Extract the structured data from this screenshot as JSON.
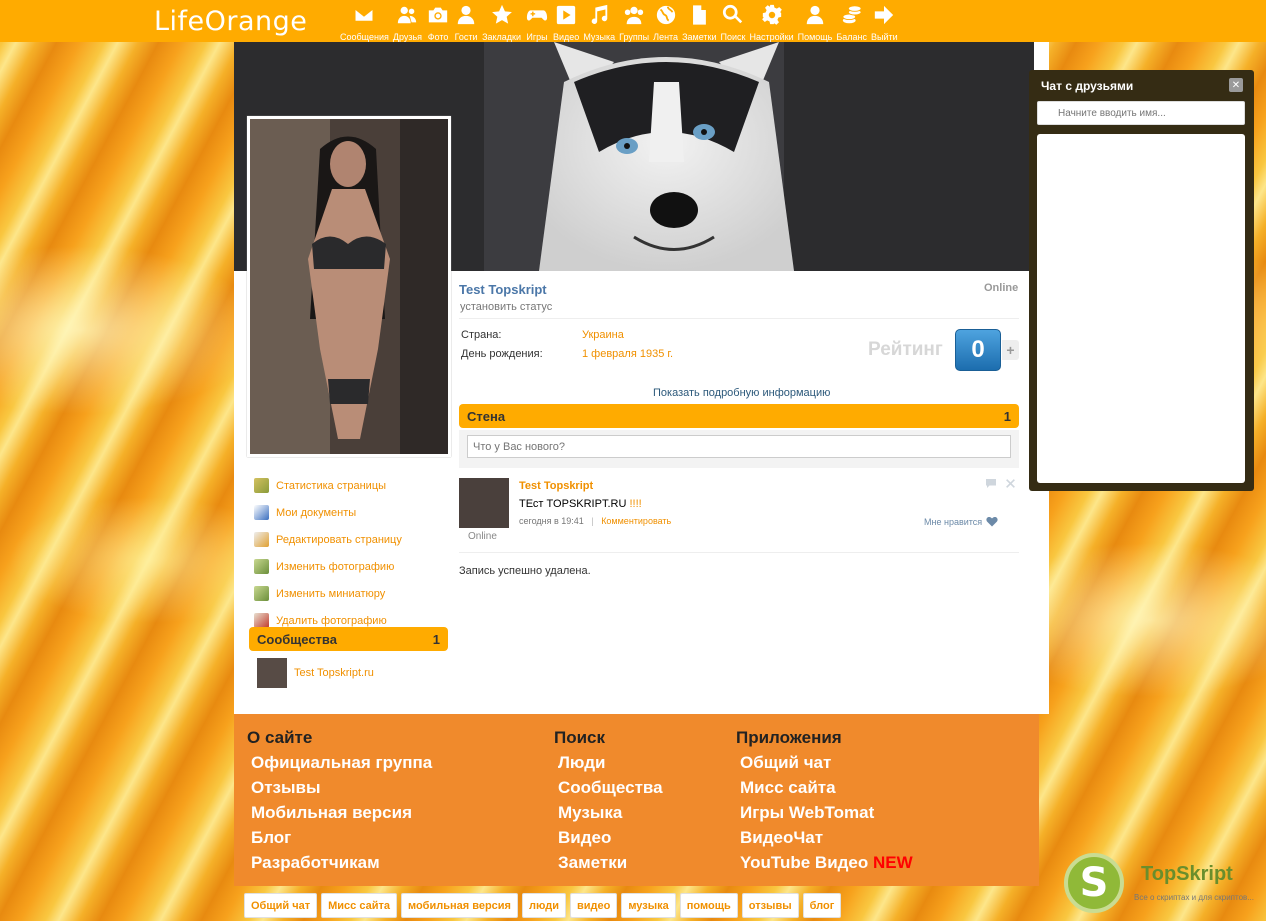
{
  "header": {
    "logo": "LifeOrange",
    "nav": [
      {
        "label": "Сообщения",
        "icon": "envelope-icon"
      },
      {
        "label": "Друзья",
        "icon": "friends-icon"
      },
      {
        "label": "Фото",
        "icon": "camera-icon"
      },
      {
        "label": "Гости",
        "icon": "guest-icon"
      },
      {
        "label": "Закладки",
        "icon": "star-icon"
      },
      {
        "label": "Игры",
        "icon": "gamepad-icon"
      },
      {
        "label": "Видео",
        "icon": "play-icon"
      },
      {
        "label": "Музыка",
        "icon": "music-icon"
      },
      {
        "label": "Группы",
        "icon": "group-icon"
      },
      {
        "label": "Лента",
        "icon": "globe-icon"
      },
      {
        "label": "Заметки",
        "icon": "note-icon"
      },
      {
        "label": "Поиск",
        "icon": "search-icon"
      },
      {
        "label": "Настройки",
        "icon": "gear-icon"
      },
      {
        "label": "Помощь",
        "icon": "help-person-icon"
      },
      {
        "label": "Баланс",
        "icon": "coins-icon"
      },
      {
        "label": "Выйти",
        "icon": "exit-arrow-icon"
      }
    ]
  },
  "sidebar": {
    "links": [
      {
        "label": "Статистика страницы",
        "icon": "chart-icon"
      },
      {
        "label": "Мои документы",
        "icon": "word-doc-icon"
      },
      {
        "label": "Редактировать страницу",
        "icon": "edit-icon"
      },
      {
        "label": "Изменить фотографию",
        "icon": "photo-edit-icon"
      },
      {
        "label": "Изменить миниатюру",
        "icon": "thumbnail-edit-icon"
      },
      {
        "label": "Удалить фотографию",
        "icon": "photo-delete-icon"
      }
    ],
    "communities": {
      "title": "Сообщества",
      "count": "1",
      "items": [
        {
          "name": "Test Topskript.ru"
        }
      ]
    }
  },
  "profile": {
    "name": "Test Topskript",
    "status": "установить статус",
    "online": "Online",
    "country_label": "Страна:",
    "country_value": "Украина",
    "birthday_label": "День рождения:",
    "birthday_value": "1 февраля 1935 г.",
    "rating_label": "Рейтинг",
    "rating_value": "0",
    "rating_plus": "+",
    "more_info": "Показать подробную информацию"
  },
  "wall": {
    "title": "Стена",
    "count": "1",
    "placeholder": "Что у Вас нового?",
    "post": {
      "author": "Test Topskript",
      "text_main": "ТЕст TOPSKRIPT.RU",
      "text_excl": "!!!!",
      "time": "сегодня в 19:41",
      "sep": "|",
      "comment": "Комментировать",
      "like": "Мне нравится",
      "online": "Online"
    },
    "deleted": "Запись успешно удалена."
  },
  "chat": {
    "title": "Чат с друзьями",
    "close": "✕",
    "placeholder": "Начните вводить имя..."
  },
  "footer": {
    "columns": [
      {
        "title": "О сайте",
        "links": [
          "Официальная группа",
          "Отзывы",
          "Мобильная версия",
          "Блог",
          "Разработчикам"
        ]
      },
      {
        "title": "Поиск",
        "links": [
          "Люди",
          "Сообщества",
          "Музыка",
          "Видео",
          "Заметки"
        ]
      },
      {
        "title": "Приложения",
        "links": [
          "Общий чат",
          "Мисс сайта",
          "Игры WebTomat",
          "ВидеоЧат",
          "YouTube Видео"
        ]
      }
    ],
    "new_badge": "NEW",
    "tags": [
      "Общий чат",
      "Мисс сайта",
      "мобильная версия",
      "люди",
      "видео",
      "музыка",
      "помощь",
      "отзывы",
      "блог"
    ]
  },
  "badge": {
    "letter": "S",
    "name": "TopSkript",
    "tagline": "Все о скриптах и для скриптов..."
  }
}
